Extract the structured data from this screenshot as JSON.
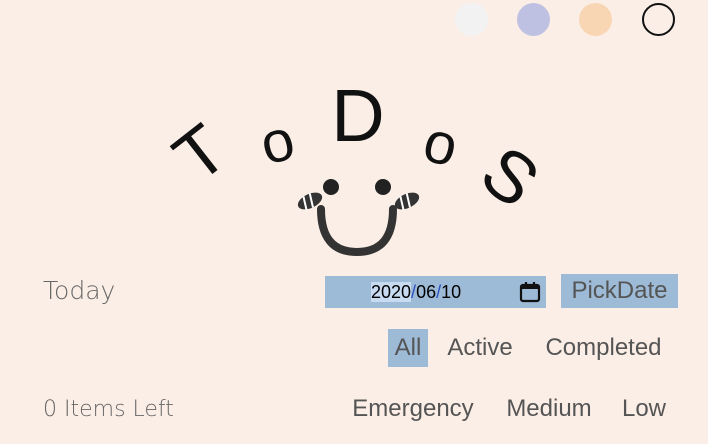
{
  "theme": {
    "swatches": [
      {
        "name": "white",
        "color": "#f2f2f2"
      },
      {
        "name": "lavender",
        "color": "#bfc1e3"
      },
      {
        "name": "peach",
        "color": "#f8d5b3"
      },
      {
        "name": "outline",
        "color": "#fbeee6"
      }
    ],
    "accent": "#9dbad6"
  },
  "logo": {
    "letters": [
      "T",
      "o",
      "D",
      "o",
      "S"
    ]
  },
  "date_row": {
    "label": "Today",
    "year": "2020",
    "month": "06",
    "day": "10",
    "separator": "/",
    "pick_button": "PickDate"
  },
  "filters": {
    "all": "All",
    "active": "Active",
    "completed": "Completed"
  },
  "footer": {
    "items_left": "0 Items Left",
    "priorities": [
      "Emergency",
      "Medium",
      "Low"
    ]
  }
}
